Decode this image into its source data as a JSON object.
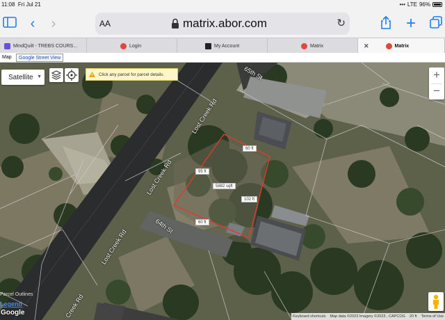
{
  "status_bar": {
    "time": "11:08",
    "date": "Fri Jul 21",
    "carrier": "LTE",
    "battery": "96%"
  },
  "browser": {
    "text_size_label": "AA",
    "url": "matrix.abor.com",
    "tabs": [
      {
        "label": "MindQuilt - TREBS COURS...",
        "color": "#6a4fd8"
      },
      {
        "label": "Login",
        "color": "#e0483a"
      },
      {
        "label": "My Account",
        "color": "#222222"
      },
      {
        "label": "Matrix",
        "color": "#e0483a"
      },
      {
        "label": "Matrix",
        "color": "#e0483a",
        "active": true
      }
    ]
  },
  "map_tabs": {
    "map": "Map",
    "street_view": "Google Street View"
  },
  "map": {
    "type_label": "Satellite",
    "notice": "Click any parcel for parcel details.",
    "zoom_in": "+",
    "zoom_out": "−",
    "streets": {
      "lost_creek_upper": "Lost Creek Rd",
      "lost_creek_lower": "Lost Creek Rd",
      "lost_creek_bottom": "Creek Rd",
      "street_65th": "65th St",
      "street_64th": "64th St"
    },
    "parcel": {
      "top": "60 ft",
      "left": "95 ft",
      "area": "5882 sqft",
      "right": "102 ft",
      "bottom": "60 ft"
    },
    "overlay_faint": "Parcel Outlines",
    "legend_link": "Legend",
    "google_logo": "Google",
    "attribution": {
      "shortcuts": "Keyboard shortcuts",
      "data": "Map data ©2023 Imagery ©2023 , CAPCOG",
      "scale": "20 ft",
      "terms": "Terms of Use"
    }
  },
  "colors": {
    "ios_blue": "#1e7cf2",
    "parcel_outline": "#e23a2e",
    "notice_bg": "#fff6c8"
  }
}
